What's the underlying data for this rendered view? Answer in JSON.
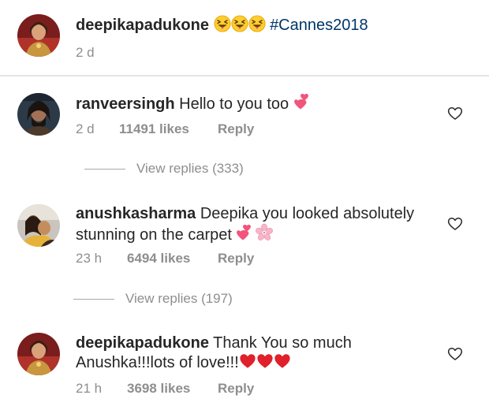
{
  "caption": {
    "username": "deepikapadukone",
    "hashtag": "#Cannes2018",
    "time": "2 d",
    "emoji_icons": [
      "squinting-face-with-tongue-icon",
      "squinting-face-with-tongue-icon",
      "squinting-face-with-tongue-icon"
    ]
  },
  "comments": [
    {
      "username": "ranveersingh",
      "text": "Hello to you too",
      "time": "2 d",
      "likes": "11491 likes",
      "reply": "Reply",
      "view_replies": "View replies (333)",
      "emoji_icons": [
        "two-hearts-icon"
      ]
    },
    {
      "username": "anushkasharma",
      "text_line1": "Deepika you looked absolutely",
      "text_line2": "stunning on the carpet",
      "time": "23 h",
      "likes": "6494 likes",
      "reply": "Reply",
      "view_replies": "View replies (197)",
      "emoji_icons": [
        "two-hearts-icon",
        "cherry-blossom-icon"
      ]
    },
    {
      "username": "deepikapadukone",
      "text_line1": "Thank You so much",
      "text_line2": "Anushka!!!lots of love!!!",
      "time": "21 h",
      "likes": "3698 likes",
      "reply": "Reply",
      "emoji_icons": [
        "red-heart-icon",
        "red-heart-icon",
        "red-heart-icon"
      ]
    }
  ],
  "colors": {
    "text": "#262626",
    "meta": "#8e8e8e",
    "hashtag": "#003569",
    "heart_red": "#e0202a",
    "pink": "#f2547c"
  }
}
